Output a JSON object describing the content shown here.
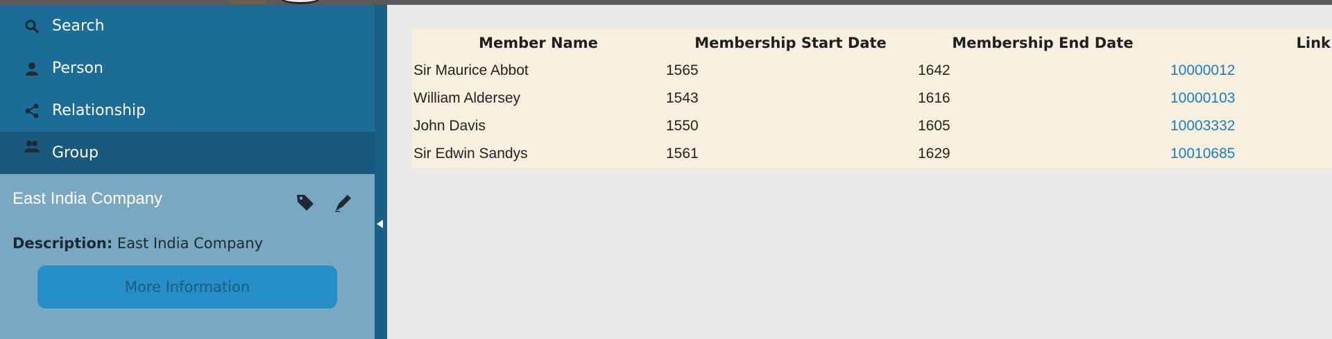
{
  "nav": {
    "items": [
      {
        "label": "Search",
        "icon": "search-icon"
      },
      {
        "label": "Person",
        "icon": "person-icon"
      },
      {
        "label": "Relationship",
        "icon": "share-icon"
      },
      {
        "label": "Group",
        "icon": "group-icon",
        "active": true
      }
    ]
  },
  "panel": {
    "title": "East India Company",
    "description_label": "Description:",
    "description_value": "East India Company",
    "more_button": "More Information"
  },
  "table": {
    "headers": [
      "Member Name",
      "Membership Start Date",
      "Membership End Date",
      "Link"
    ],
    "rows": [
      {
        "name": "Sir Maurice Abbot",
        "start": "1565",
        "end": "1642",
        "link": "10000012"
      },
      {
        "name": "William Aldersey",
        "start": "1543",
        "end": "1616",
        "link": "10000103"
      },
      {
        "name": "John Davis",
        "start": "1550",
        "end": "1605",
        "link": "10003332"
      },
      {
        "name": "Sir Edwin Sandys",
        "start": "1561",
        "end": "1629",
        "link": "10010685"
      }
    ]
  },
  "colors": {
    "sidebar": "#1b6d97",
    "sidebar_active": "#19597e",
    "panel": "#7aa8c2",
    "button": "#258ec6",
    "table_bg": "#f8f0df",
    "link": "#1b7dc0",
    "page_bg": "#ebeae8"
  }
}
